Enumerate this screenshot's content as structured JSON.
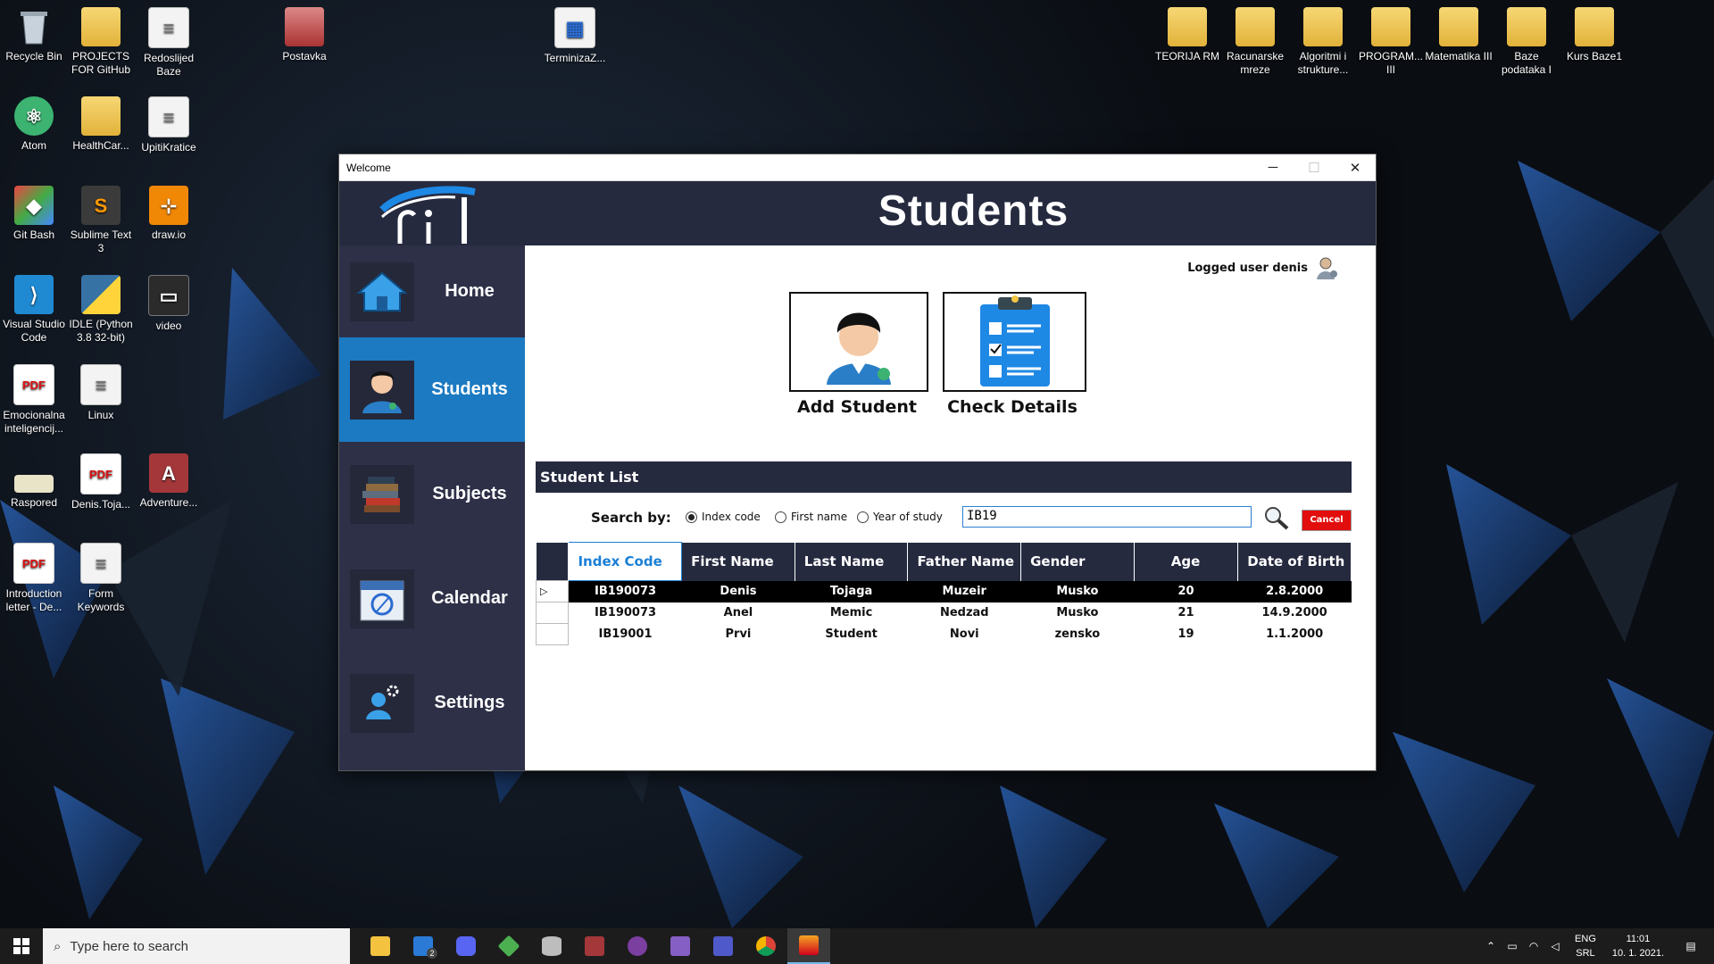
{
  "desktop": {
    "icons": [
      {
        "label": "Recycle Bin",
        "icon": "recycle-bin-icon"
      },
      {
        "label": "PROJECTS FOR GitHub",
        "icon": "folder-icon"
      },
      {
        "label": "Redoslijed Baze",
        "icon": "document-icon"
      },
      {
        "label": "Postavka",
        "icon": "archive-icon"
      },
      {
        "label": "TerminizaZ...",
        "icon": "calendar-file-icon"
      },
      {
        "label": "TEORIJA RM",
        "icon": "folder-icon"
      },
      {
        "label": "Racunarske mreze",
        "icon": "folder-icon"
      },
      {
        "label": "Algoritmi i strukture...",
        "icon": "folder-icon"
      },
      {
        "label": "PROGRAM... III",
        "icon": "pdf-folder-icon"
      },
      {
        "label": "Matematika III",
        "icon": "folder-icon"
      },
      {
        "label": "Baze podataka I",
        "icon": "folder-icon"
      },
      {
        "label": "Kurs Baze1",
        "icon": "folder-icon"
      },
      {
        "label": "Atom",
        "icon": "atom-icon"
      },
      {
        "label": "HealthCar...",
        "icon": "archive-icon"
      },
      {
        "label": "UpitiKratice",
        "icon": "document-icon"
      },
      {
        "label": "Git Bash",
        "icon": "git-bash-icon"
      },
      {
        "label": "Sublime Text 3",
        "icon": "sublime-icon"
      },
      {
        "label": "draw.io",
        "icon": "drawio-icon"
      },
      {
        "label": "Visual Studio Code",
        "icon": "vscode-icon"
      },
      {
        "label": "IDLE (Python 3.8 32-bit)",
        "icon": "python-icon"
      },
      {
        "label": "video",
        "icon": "video-icon"
      },
      {
        "label": "Emocionalna inteligencij...",
        "icon": "pdf-icon"
      },
      {
        "label": "Linux",
        "icon": "document-icon"
      },
      {
        "label": "Raspored",
        "icon": "image-icon"
      },
      {
        "label": "Denis.Toja...",
        "icon": "pdf-icon"
      },
      {
        "label": "Adventure...",
        "icon": "access-icon"
      },
      {
        "label": "Introduction letter - De...",
        "icon": "pdf-icon"
      },
      {
        "label": "Form Keywords",
        "icon": "document-icon"
      }
    ]
  },
  "window": {
    "title": "Welcome",
    "minimize": "─",
    "maximize": "☐",
    "close": "✕"
  },
  "app": {
    "title": "Students",
    "logged_user": "Logged user denis",
    "nav": [
      {
        "label": "Home",
        "icon": "home-icon",
        "active": false
      },
      {
        "label": "Students",
        "icon": "student-icon",
        "active": true
      },
      {
        "label": "Subjects",
        "icon": "books-icon",
        "active": false
      },
      {
        "label": "Calendar",
        "icon": "calendar-icon",
        "active": false
      },
      {
        "label": "Settings",
        "icon": "user-settings-icon",
        "active": false
      }
    ],
    "actions": {
      "add_student": "Add Student",
      "check_details": "Check Details"
    },
    "student_list": {
      "header": "Student List",
      "search_by": "Search by:",
      "options": [
        {
          "label": "Index code",
          "checked": true
        },
        {
          "label": "First name",
          "checked": false
        },
        {
          "label": "Year of study",
          "checked": false
        }
      ],
      "search_value": "IB19",
      "cancel": "Cancel",
      "columns": [
        "Index Code",
        "First Name",
        "Last Name",
        "Father Name",
        "Gender",
        "Age",
        "Date of Birth"
      ],
      "rows": [
        {
          "index": "IB190073",
          "first": "Denis",
          "last": "Tojaga",
          "father": "Muzeir",
          "gender": "Musko",
          "age": "20",
          "dob": "2.8.2000",
          "marker": "▷"
        },
        {
          "index": "IB190073",
          "first": "Anel",
          "last": "Memic",
          "father": "Nedzad",
          "gender": "Musko",
          "age": "21",
          "dob": "14.9.2000",
          "marker": ""
        },
        {
          "index": "IB19001",
          "first": "Prvi",
          "last": "Student",
          "father": "Novi",
          "gender": "zensko",
          "age": "19",
          "dob": "1.1.2000",
          "marker": ""
        }
      ]
    }
  },
  "taskbar": {
    "search_placeholder": "Type here to search",
    "mail_badge": "2",
    "lang_top": "ENG",
    "lang_bottom": "SRL",
    "time": "11:01",
    "date": "10. 1. 2021."
  },
  "colors": {
    "header": "#252a3f",
    "sidebar": "#2d3047",
    "active": "#1b7ac2",
    "cancel": "#e20d0d"
  }
}
